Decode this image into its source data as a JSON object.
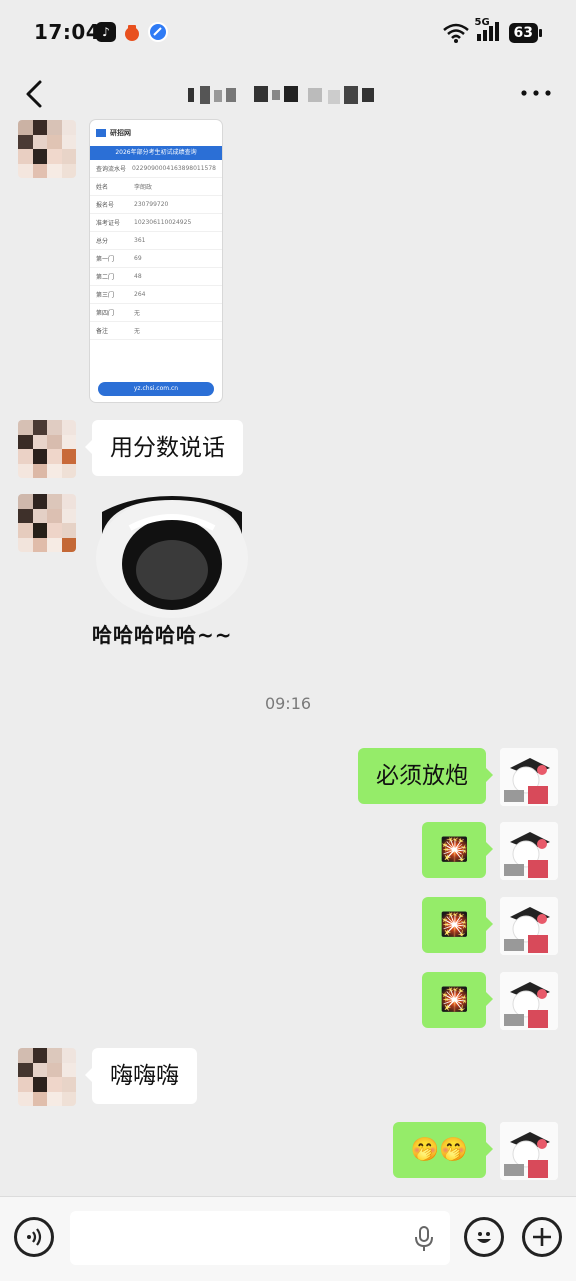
{
  "status_bar": {
    "time": "17:04",
    "network": "5G",
    "battery": "63"
  },
  "header": {
    "title": "",
    "more_label": "···"
  },
  "messages": {
    "shared_image": {
      "site_name": "研招网",
      "banner": "2026年部分考生初试成绩查询",
      "rows": [
        {
          "k": "查询流水号",
          "v": "0229090004163898011578"
        },
        {
          "k": "姓名",
          "v": "李朗政"
        },
        {
          "k": "报名号",
          "v": "230799720"
        },
        {
          "k": "准考证号",
          "v": "102306110024925"
        },
        {
          "k": "总分",
          "v": "361"
        },
        {
          "k": "第一门",
          "v": "69"
        },
        {
          "k": "第二门",
          "v": "48"
        },
        {
          "k": "第三门",
          "v": "264"
        },
        {
          "k": "第四门",
          "v": "无"
        },
        {
          "k": "备注",
          "v": "无"
        }
      ],
      "url": "yz.chsi.com.cn"
    },
    "text_1": "用分数说话",
    "sticker_caption": "哈哈哈哈哈~~",
    "timestamp": "09:16",
    "my_text_1": "必须放炮",
    "firework": "🎇",
    "text_2": "嗨嗨嗨",
    "my_emoji": "🤭🤭"
  },
  "colors": {
    "background": "#ededed",
    "my_bubble": "#95ec69",
    "their_bubble": "#ffffff"
  }
}
